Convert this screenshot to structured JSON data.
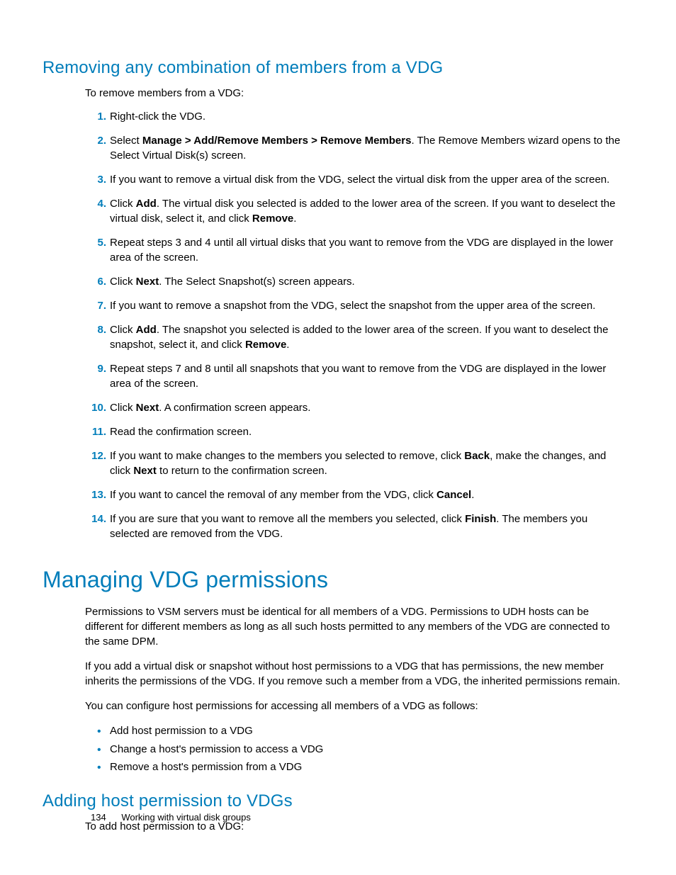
{
  "section1": {
    "heading": "Removing any combination of members from a VDG",
    "intro": "To remove members from a VDG:",
    "steps": [
      {
        "num": "1.",
        "html": "Right-click the VDG."
      },
      {
        "num": "2.",
        "html": "Select <b>Manage > Add/Remove Members > Remove Members</b>. The Remove Members wizard opens to the Select Virtual Disk(s) screen."
      },
      {
        "num": "3.",
        "html": "If you want to remove a virtual disk from the VDG, select the virtual disk from the upper area of the screen."
      },
      {
        "num": "4.",
        "html": "Click <b>Add</b>. The virtual disk you selected is added to the lower area of the screen. If you want to deselect the virtual disk, select it, and click <b>Remove</b>."
      },
      {
        "num": "5.",
        "html": "Repeat steps 3 and 4 until all virtual disks that you want to remove from the VDG are displayed in the lower area of the screen."
      },
      {
        "num": "6.",
        "html": "Click <b>Next</b>. The Select Snapshot(s) screen appears."
      },
      {
        "num": "7.",
        "html": "If you want to remove a snapshot from the VDG, select the snapshot from the upper area of the screen."
      },
      {
        "num": "8.",
        "html": "Click <b>Add</b>. The snapshot you selected is added to the lower area of the screen. If you want to deselect the snapshot, select it, and click <b>Remove</b>."
      },
      {
        "num": "9.",
        "html": "Repeat steps 7 and 8 until all snapshots that you want to remove from the VDG are displayed in the lower area of the screen."
      },
      {
        "num": "10.",
        "html": "Click <b>Next</b>. A confirmation screen appears."
      },
      {
        "num": "11.",
        "html": "Read the confirmation screen."
      },
      {
        "num": "12.",
        "html": "If you want to make changes to the members you selected to remove, click <b>Back</b>, make the changes, and click <b>Next</b> to return to the confirmation screen."
      },
      {
        "num": "13.",
        "html": "If you want to cancel the removal of any member from the VDG, click <b>Cancel</b>."
      },
      {
        "num": "14.",
        "html": "If you are sure that you want to remove all the members you selected, click <b>Finish</b>. The members you selected are removed from the VDG."
      }
    ]
  },
  "section2": {
    "heading": "Managing VDG permissions",
    "paras": [
      "Permissions to VSM servers must be identical for all members of a VDG. Permissions to UDH hosts can be different for different members as long as all such hosts permitted to any members of the VDG are connected to the same DPM.",
      "If you add a virtual disk or snapshot without host permissions to a VDG that has permissions, the new member inherits the permissions of the VDG. If you remove such a member from a VDG, the inherited permissions remain.",
      "You can configure host permissions for accessing all members of a VDG as follows:"
    ],
    "bullets": [
      "Add host permission to a VDG",
      "Change a host's permission to access a VDG",
      "Remove a host's permission from a VDG"
    ]
  },
  "section3": {
    "heading": "Adding host permission to VDGs",
    "intro": "To add host permission to a VDG:"
  },
  "footer": {
    "page": "134",
    "title": "Working with virtual disk groups"
  }
}
